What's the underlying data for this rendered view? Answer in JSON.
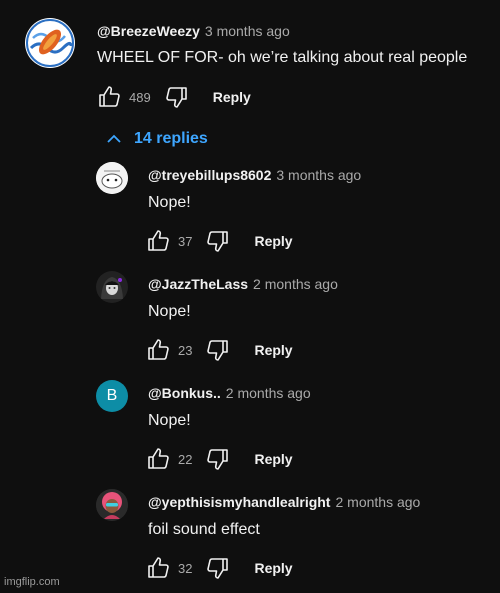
{
  "top_comment": {
    "handle": "@BreezeWeezy",
    "time": "3 months ago",
    "text": "WHEEL OF FOR- oh we’re talking about real people",
    "likes": "489",
    "reply_label": "Reply"
  },
  "replies_toggle": {
    "label": "14 replies"
  },
  "replies": [
    {
      "handle": "@treyebillups8602",
      "time": "3 months ago",
      "text": "Nope!",
      "likes": "37",
      "reply_label": "Reply",
      "avatar_letter": ""
    },
    {
      "handle": "@JazzTheLass",
      "time": "2 months ago",
      "text": "Nope!",
      "likes": "23",
      "reply_label": "Reply",
      "avatar_letter": ""
    },
    {
      "handle": "@Bonkus..",
      "time": "2 months ago",
      "text": "Nope!",
      "likes": "22",
      "reply_label": "Reply",
      "avatar_letter": "B"
    },
    {
      "handle": "@yepthisismyhandlealright",
      "time": "2 months ago",
      "text": "foil sound effect",
      "likes": "32",
      "reply_label": "Reply",
      "avatar_letter": ""
    }
  ],
  "watermark": "imgflip.com",
  "colors": {
    "background": "#0f0f0f",
    "link": "#3ea6ff",
    "muted": "#aaaaaa",
    "bonkus_avatar": "#0d8da6"
  }
}
